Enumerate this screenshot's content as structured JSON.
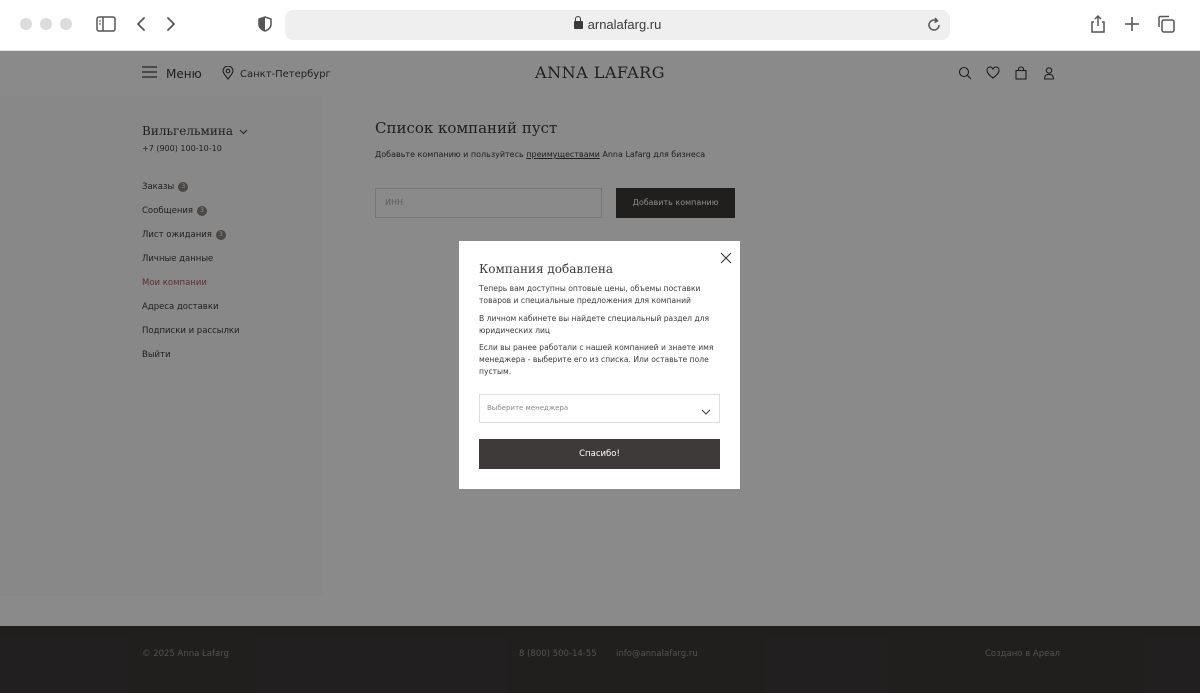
{
  "browser": {
    "url": "arnalafarg.ru"
  },
  "header": {
    "menu_label": "Меню",
    "city": "Санкт-Петербург",
    "logo": "ANNA LAFARG"
  },
  "sidebar": {
    "user_name": "Вильгельмина",
    "user_phone": "+7 (900) 100-10-10",
    "items": [
      {
        "label": "Заказы",
        "badge": "3"
      },
      {
        "label": "Сообщения",
        "badge": "3"
      },
      {
        "label": "Лист ожидания",
        "badge": "3"
      },
      {
        "label": "Личные данные",
        "badge": ""
      },
      {
        "label": "Мои компании",
        "badge": ""
      },
      {
        "label": "Адреса доставки",
        "badge": ""
      },
      {
        "label": "Подписки и рассылки",
        "badge": ""
      },
      {
        "label": "Выйти",
        "badge": ""
      }
    ]
  },
  "main": {
    "title": "Список компаний пуст",
    "subtitle_prefix": "Добавьте компанию и пользуйтесь ",
    "subtitle_link": "преимуществами",
    "subtitle_suffix": " Anna Lafarg для бизнеса",
    "inn_placeholder": "ИНН",
    "add_button": "Добавить компанию"
  },
  "modal": {
    "title": "Компания добавлена",
    "p1": "Теперь вам доступны оптовые цены, объемы поставки товаров и специальные предложения для компаний",
    "p2": "В личном кабинете вы найдете специальный раздел для юридических лиц",
    "p3": "Если вы ранее работали с нашей компанией и знаете имя менеджера - выберите его из списка. Или оставьте поле пустым.",
    "select_placeholder": "Выберите менеджера",
    "confirm_button": "Спасибо!"
  },
  "footer": {
    "copyright": "© 2025 Anna Lafarg",
    "phone": "8 (800) 500-14-55",
    "email": "info@annalafarg.ru",
    "made_by": "Создано в Ареал"
  },
  "colors": {
    "dark": "#3d3a39",
    "accent": "#b5525a",
    "overlay": "rgba(0,0,0,0.46)"
  }
}
